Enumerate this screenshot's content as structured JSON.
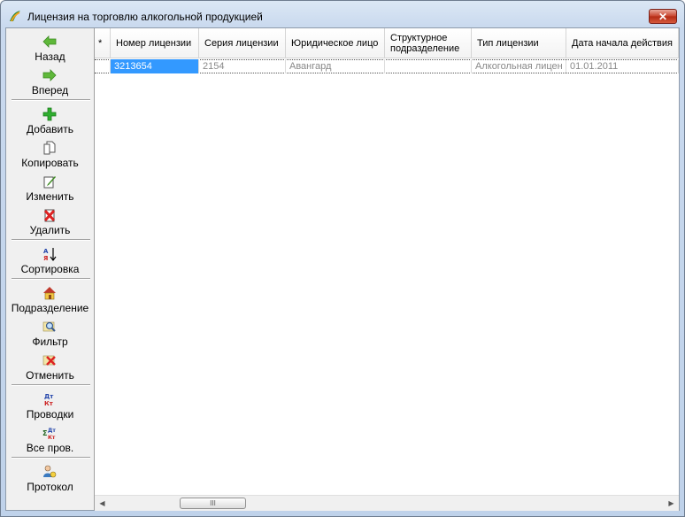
{
  "window": {
    "title": "Лицензия на торговлю алкогольной продукцией",
    "close_label": "✕"
  },
  "toolbar": {
    "items": [
      {
        "id": "back",
        "label": "Назад",
        "icon": "arrow-left-icon"
      },
      {
        "id": "forward",
        "label": "Вперед",
        "icon": "arrow-right-icon"
      },
      {
        "id": "add",
        "label": "Добавить",
        "icon": "plus-icon"
      },
      {
        "id": "copy",
        "label": "Копировать",
        "icon": "copy-icon"
      },
      {
        "id": "edit",
        "label": "Изменить",
        "icon": "edit-icon"
      },
      {
        "id": "delete",
        "label": "Удалить",
        "icon": "delete-icon"
      },
      {
        "id": "sort",
        "label": "Сортировка",
        "icon": "sort-az-icon"
      },
      {
        "id": "division",
        "label": "Подразделение",
        "icon": "house-icon"
      },
      {
        "id": "filter",
        "label": "Фильтр",
        "icon": "filter-icon"
      },
      {
        "id": "cancel",
        "label": "Отменить",
        "icon": "cancel-filter-icon"
      },
      {
        "id": "postings",
        "label": "Проводки",
        "icon": "debit-credit-icon"
      },
      {
        "id": "all_postings",
        "label": "Все пров.",
        "icon": "sum-debit-credit-icon"
      },
      {
        "id": "protocol",
        "label": "Протокол",
        "icon": "protocol-icon"
      }
    ]
  },
  "grid": {
    "marker_header": "*",
    "columns": [
      "Номер лицензии",
      "Серия лицензии",
      "Юридическое лицо",
      "Структурное подразделение",
      "Тип лицензии",
      "Дата начала действия"
    ],
    "rows": [
      [
        "3213654",
        "2154",
        "Авангард",
        "",
        "Алкогольная лицен",
        "01.01.2011"
      ]
    ]
  },
  "scrollbar": {
    "left_arrow": "◀",
    "right_arrow": "▶",
    "thumb_grip": "III"
  },
  "colors": {
    "selection": "#3399ff",
    "title_gradient": "#c9d9ee",
    "close_button": "#c7412a"
  }
}
